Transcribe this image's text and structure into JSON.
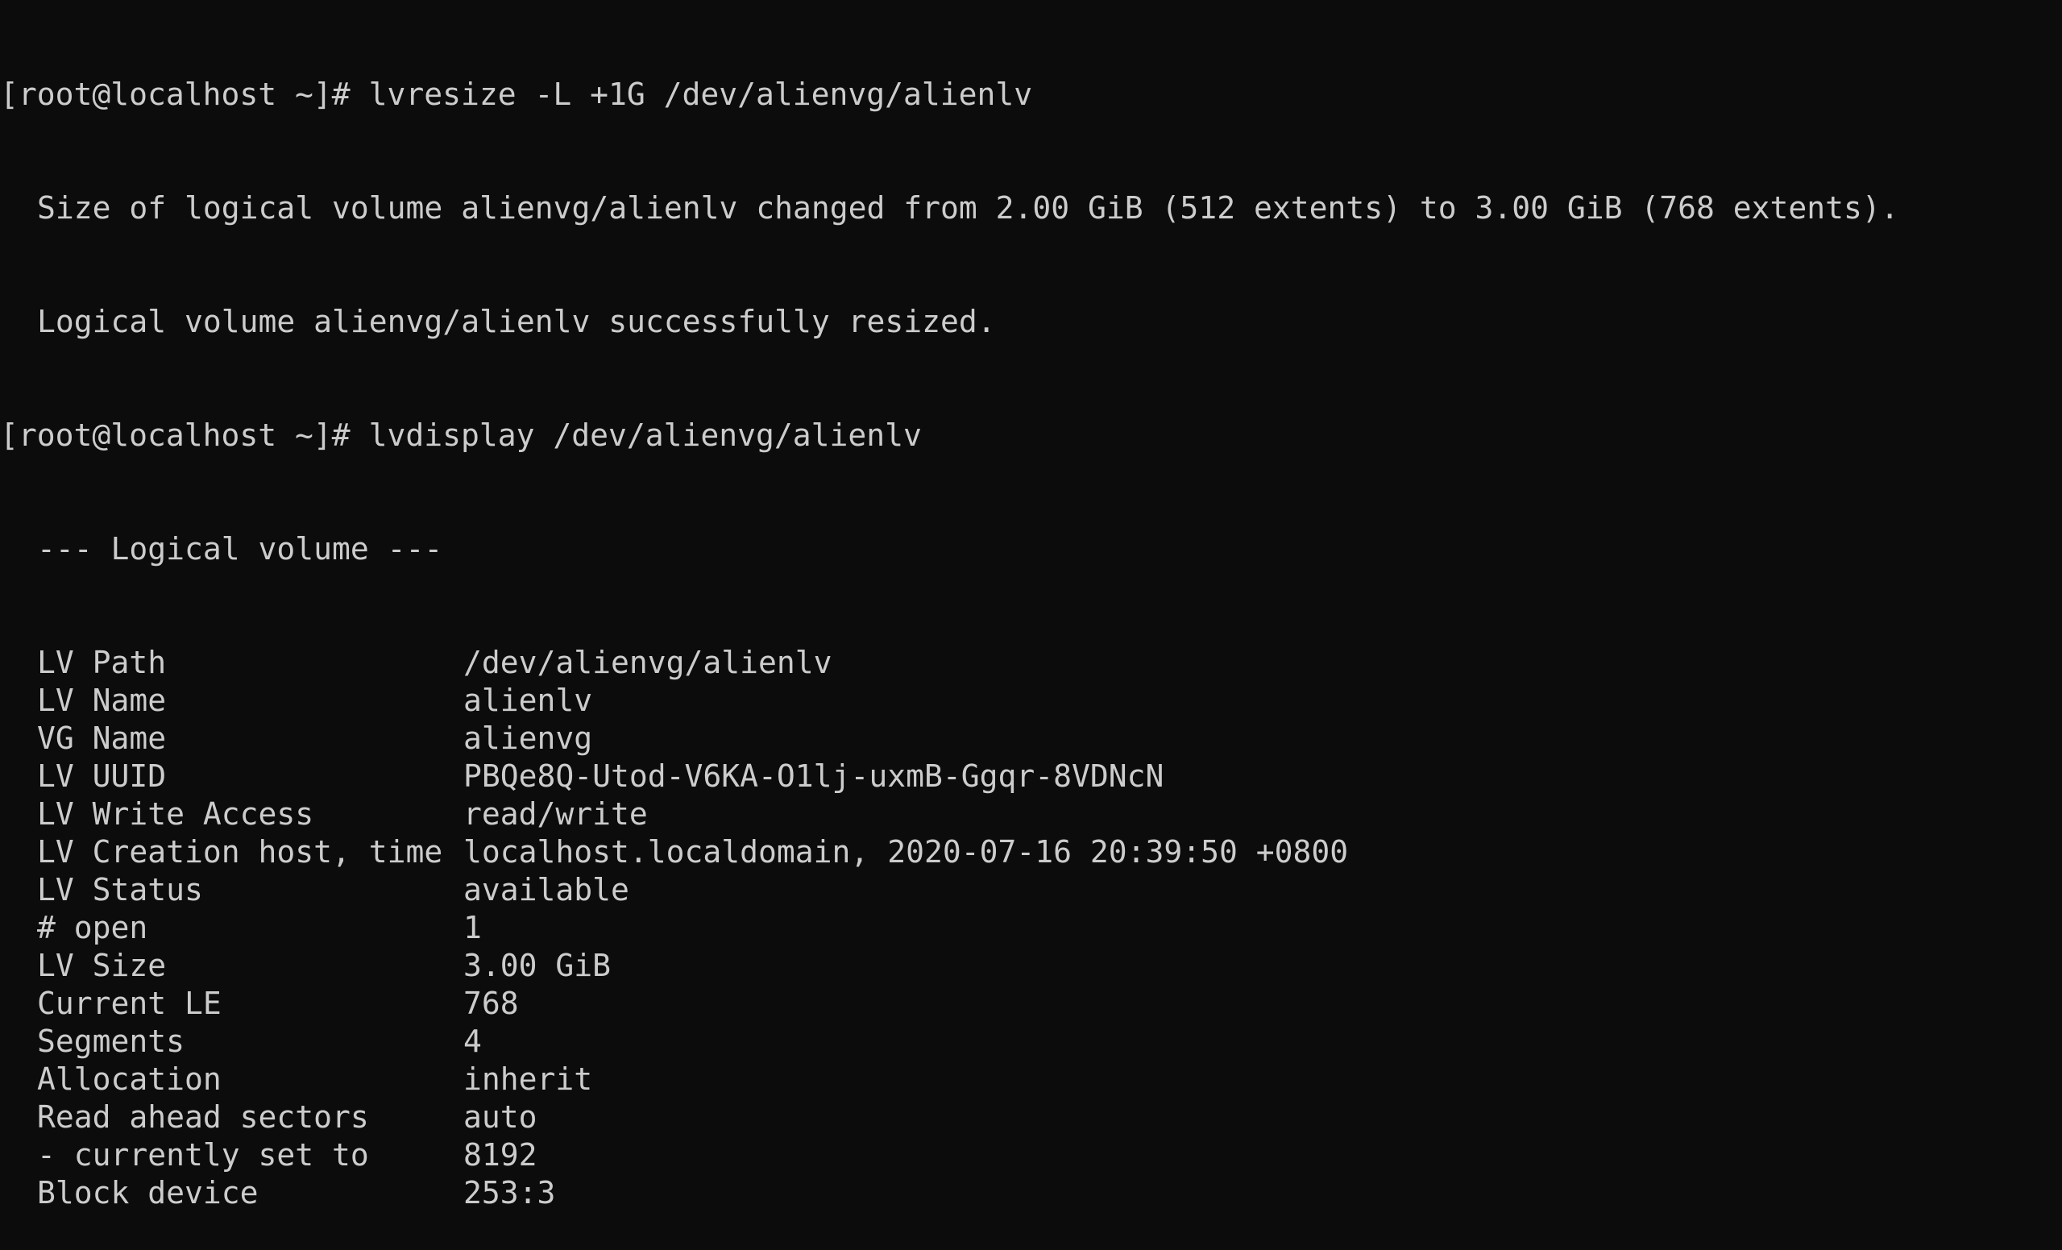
{
  "colors": {
    "background": "#0c0c0c",
    "foreground": "#cccccc"
  },
  "terminal": {
    "prompt": "[root@localhost ~]#",
    "commands": [
      "lvresize -L +1G /dev/alienvg/alienlv",
      "lvdisplay /dev/alienvg/alienlv"
    ],
    "resize_output": [
      "Size of logical volume alienvg/alienlv changed from 2.00 GiB (512 extents) to 3.00 GiB (768 extents).",
      "Logical volume alienvg/alienlv successfully resized."
    ],
    "display_header": "--- Logical volume ---",
    "fields": [
      {
        "key": "LV Path",
        "value": "/dev/alienvg/alienlv"
      },
      {
        "key": "LV Name",
        "value": "alienlv"
      },
      {
        "key": "VG Name",
        "value": "alienvg"
      },
      {
        "key": "LV UUID",
        "value": "PBQe8Q-Utod-V6KA-O1lj-uxmB-Ggqr-8VDNcN"
      },
      {
        "key": "LV Write Access",
        "value": "read/write"
      },
      {
        "key": "LV Creation host, time",
        "value": "localhost.localdomain, 2020-07-16 20:39:50 +0800"
      },
      {
        "key": "LV Status",
        "value": "available"
      },
      {
        "key": "# open",
        "value": "1"
      },
      {
        "key": "LV Size",
        "value": "3.00 GiB"
      },
      {
        "key": "Current LE",
        "value": "768"
      },
      {
        "key": "Segments",
        "value": "4"
      },
      {
        "key": "Allocation",
        "value": "inherit"
      },
      {
        "key": "Read ahead sectors",
        "value": "auto"
      },
      {
        "key": "- currently set to",
        "value": "8192"
      },
      {
        "key": "Block device",
        "value": "253:3"
      }
    ]
  }
}
